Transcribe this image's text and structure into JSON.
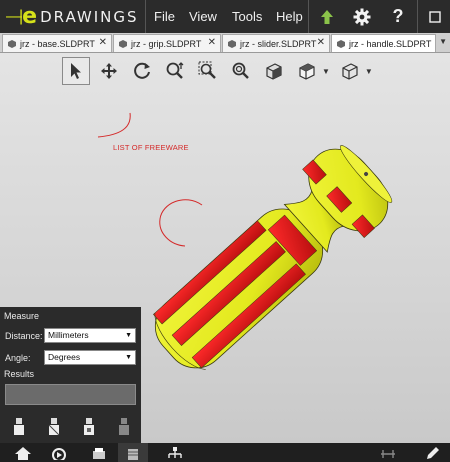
{
  "app": {
    "logo_letter": "e",
    "logo_text": "DRAWINGS"
  },
  "menu": {
    "file": "File",
    "view": "View",
    "tools": "Tools",
    "help": "Help"
  },
  "toolbar_icons": [
    "up-arrow-icon",
    "gear-icon",
    "help-icon",
    "window-icon"
  ],
  "tabs": [
    {
      "label": "jrz - base.SLDPRT",
      "close": "✕"
    },
    {
      "label": "jrz - grip.SLDPRT",
      "close": "✕"
    },
    {
      "label": "jrz - slider.SLDPRT",
      "close": "✕"
    },
    {
      "label": "jrz - handle.SLDPRT",
      "close": ""
    }
  ],
  "tab_menu_glyph": "▼",
  "view_toolbar": [
    "select-icon",
    "pan-icon",
    "rotate-icon",
    "zoom-icon",
    "zoom-to-area-icon",
    "zoom-to-fit-icon",
    "view-orientation-icon",
    "display-style-icon",
    "section-view-icon"
  ],
  "markup": {
    "text": "LIST OF FREEWARE"
  },
  "measure": {
    "title": "Measure",
    "distance_label": "Distance:",
    "distance_value": "Millimeters",
    "angle_label": "Angle:",
    "angle_value": "Degrees",
    "results_label": "Results",
    "results_value": ""
  },
  "colors": {
    "model_yellow": "#e6ec1f",
    "model_red": "#e01818",
    "markup_red": "#d42a2a",
    "logo_accent": "#d6e21a"
  }
}
